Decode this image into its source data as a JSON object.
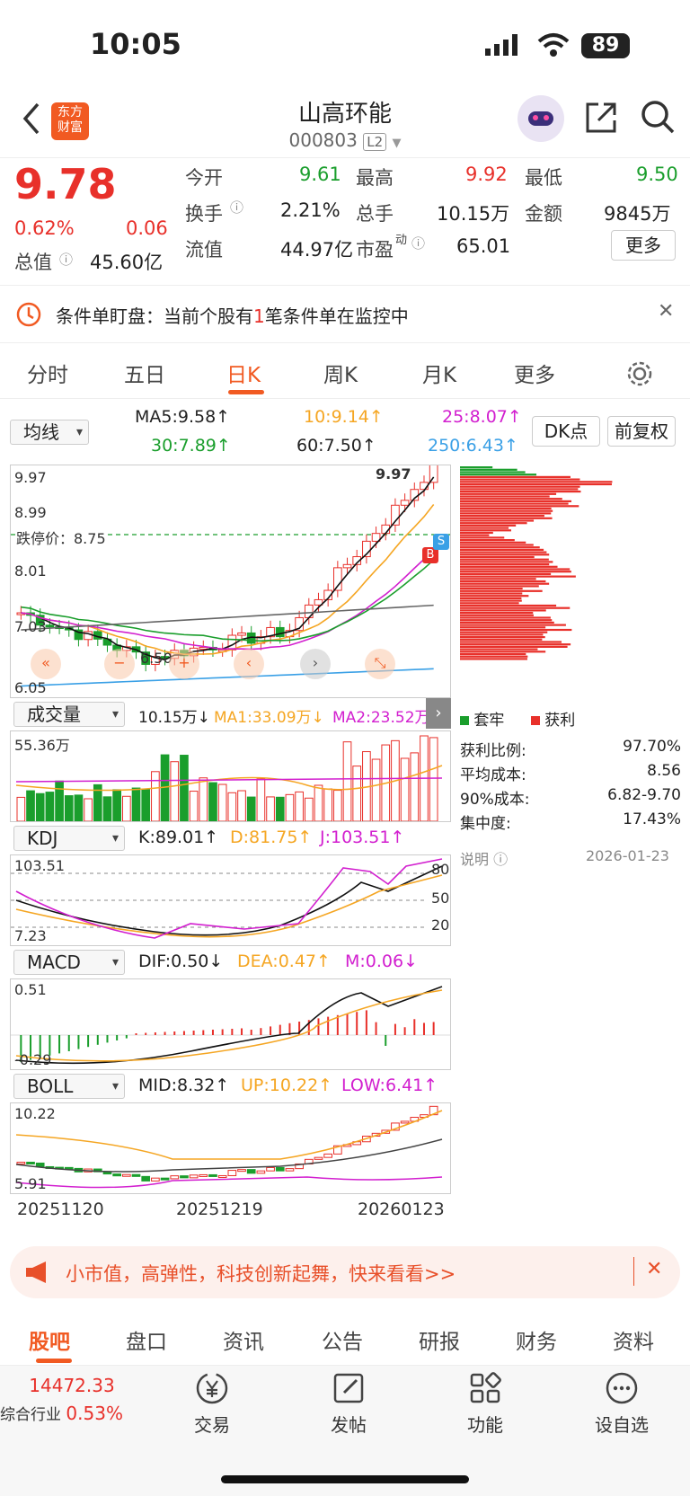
{
  "status": {
    "time": "10:05",
    "battery": "89"
  },
  "header": {
    "title": "山高环能",
    "code": "000803",
    "level": "L2",
    "logo": "东方\n财富"
  },
  "quote": {
    "price": "9.78",
    "pct": "0.62%",
    "chg": "0.06",
    "open_l": "今开",
    "open": "9.61",
    "high_l": "最高",
    "high": "9.92",
    "low_l": "最低",
    "low": "9.50",
    "turn_l": "换手",
    "turn": "2.21%",
    "vol_l": "总手",
    "vol": "10.15万",
    "amt_l": "金额",
    "amt": "9845万",
    "cap_l": "总值",
    "cap": "45.60亿",
    "flt_l": "流值",
    "flt": "44.97亿",
    "pe_l": "市盈",
    "pe_sup": "动",
    "pe": "65.01",
    "more": "更多"
  },
  "alert": {
    "prefix": "条件单盯盘：当前个股有",
    "num": "1",
    "suffix": "笔条件单在监控中"
  },
  "tabs": [
    "分时",
    "五日",
    "日K",
    "周K",
    "月K",
    "更多"
  ],
  "ma": {
    "sel": "均线",
    "ma5": "MA5:9.58↑",
    "ma10": "10:9.14↑",
    "ma25": "25:8.07↑",
    "ma30": "30:7.89↑",
    "ma60": "60:7.50↑",
    "ma250": "250:6.43↑",
    "dk": "DK点",
    "fq": "前复权"
  },
  "kline": {
    "ymax": "9.97",
    "y2": "8.99",
    "y3": "8.01",
    "y4": "7.03",
    "ymin": "6.05",
    "limit": "跌停价：8.75",
    "hi_mark": "9.97",
    "lo_mark": "6.50",
    "b": "B",
    "s": "S"
  },
  "chip": {
    "legend_a": "套牢",
    "legend_b": "获利",
    "rows": [
      [
        "获利比例:",
        "97.70%"
      ],
      [
        "平均成本:",
        "8.56"
      ],
      [
        "90%成本:",
        "6.82-9.70"
      ],
      [
        "集中度:",
        "17.43%"
      ]
    ],
    "note": "说明",
    "date": "2026-01-23"
  },
  "volume": {
    "sel": "成交量",
    "v": "10.15万↓",
    "ma1": "MA1:33.09万↓",
    "ma2": "MA2:23.52万↑",
    "ymax": "55.36万"
  },
  "kdj": {
    "sel": "KDJ",
    "k": "K:89.01↑",
    "d": "D:81.75↑",
    "j": "J:103.51↑",
    "ymax": "103.51",
    "ymin": "7.23",
    "l80": "80",
    "l50": "50",
    "l20": "20"
  },
  "macd": {
    "sel": "MACD",
    "dif": "DIF:0.50↓",
    "dea": "DEA:0.47↑",
    "m": "M:0.06↓",
    "ymax": "0.51",
    "ymin": "-0.29"
  },
  "boll": {
    "sel": "BOLL",
    "mid": "MID:8.32↑",
    "up": "UP:10.22↑",
    "low": "LOW:6.41↑",
    "ymax": "10.22",
    "ymin": "5.91"
  },
  "dates": [
    "20251120",
    "20251219",
    "20260123"
  ],
  "banner": "小市值，高弹性，科技创新起舞，快来看看>>",
  "btabs": [
    "股吧",
    "盘口",
    "资讯",
    "公告",
    "研报",
    "财务",
    "资料"
  ],
  "bottom": {
    "idx": "14472.33",
    "idx_name": "综合行业",
    "idx_pct": "0.53%",
    "items": [
      "交易",
      "发帖",
      "功能",
      "设自选"
    ]
  },
  "colors": {
    "up": "#e8302a",
    "down": "#1a9e2c",
    "ma10": "#f5a623",
    "ma25": "#d21fcf",
    "ma250": "#3aa0e6"
  }
}
